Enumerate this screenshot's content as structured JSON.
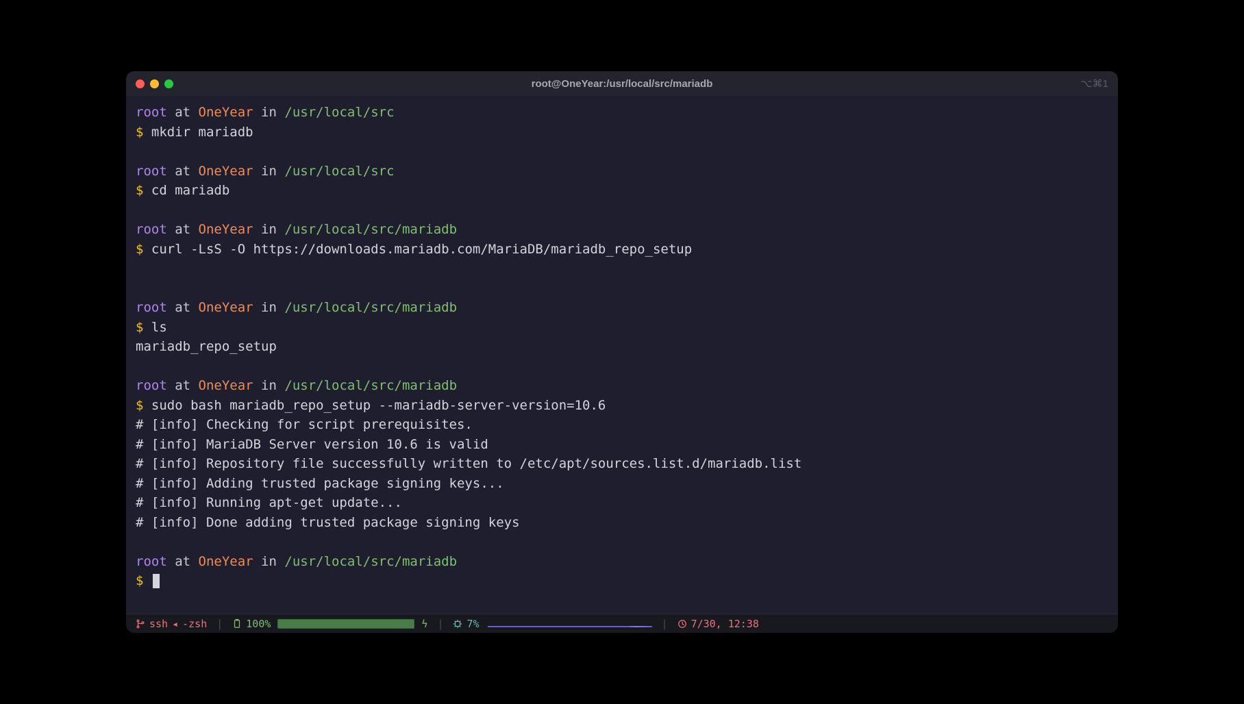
{
  "window": {
    "title": "root@OneYear:/usr/local/src/mariadb",
    "shortcut": "⌥⌘1"
  },
  "prompt": {
    "user": "root",
    "at": " at ",
    "host": "OneYear",
    "in": " in ",
    "sigil": "$"
  },
  "blocks": [
    {
      "path": "/usr/local/src",
      "cmd": "mkdir mariadb",
      "output": []
    },
    {
      "path": "/usr/local/src",
      "cmd": "cd mariadb",
      "output": []
    },
    {
      "path": "/usr/local/src/mariadb",
      "cmd": "curl -LsS -O https://downloads.mariadb.com/MariaDB/mariadb_repo_setup",
      "output": [
        ""
      ]
    },
    {
      "path": "/usr/local/src/mariadb",
      "cmd": "ls",
      "output": [
        "mariadb_repo_setup"
      ]
    },
    {
      "path": "/usr/local/src/mariadb",
      "cmd": "sudo bash mariadb_repo_setup --mariadb-server-version=10.6",
      "output": [
        "# [info] Checking for script prerequisites.",
        "# [info] MariaDB Server version 10.6 is valid",
        "# [info] Repository file successfully written to /etc/apt/sources.list.d/mariadb.list",
        "# [info] Adding trusted package signing keys...",
        "# [info] Running apt-get update...",
        "# [info] Done adding trusted package signing keys"
      ]
    },
    {
      "path": "/usr/local/src/mariadb",
      "cmd": "",
      "output": [],
      "cursor": true
    }
  ],
  "status": {
    "ssh": "ssh",
    "triangle": "◂",
    "shell": "-zsh",
    "battery_pct": "100%",
    "bolt": "ϟ",
    "cpu_pct": "7%",
    "time": "7/30, 12:38"
  }
}
